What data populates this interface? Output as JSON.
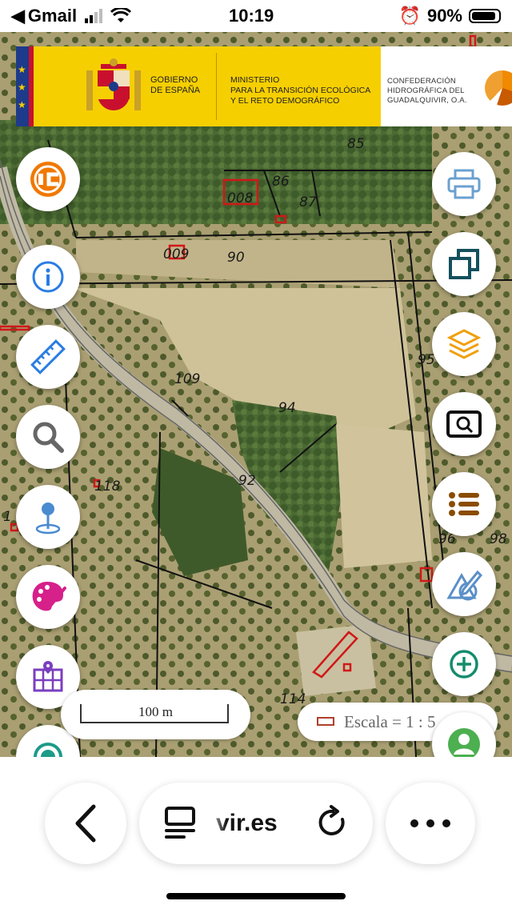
{
  "status_bar": {
    "back_app": "Gmail",
    "time": "10:19",
    "battery_percent": "90%",
    "battery_level": 0.9,
    "signal_bars_on": 2
  },
  "banner": {
    "gov_line1": "GOBIERNO",
    "gov_line2": "DE ESPAÑA",
    "ministry_line1": "MINISTERIO",
    "ministry_line2": "PARA LA TRANSICIÓN ECOLÓGICA",
    "ministry_line3": "Y EL RETO DEMOGRÁFICO",
    "chg_line1": "CONFEDERACIÓN",
    "chg_line2": "HIDROGRÁFICA DEL",
    "chg_line3": "GUADALQUIVIR, O.A.",
    "colors": {
      "yellow": "#f6cf00",
      "blue": "#1e3a8a",
      "red": "#c8102e"
    }
  },
  "map": {
    "parcels": {
      "p85": "85",
      "p86": "86",
      "p87": "87",
      "p008": "008",
      "p009": "009",
      "p90": "90",
      "p95": "95",
      "p94": "94",
      "p109": "109",
      "p92": "92",
      "p118": "118",
      "p1": "1",
      "p96": "96",
      "p98": "98",
      "p114": "114"
    },
    "scale_bar_label": "100 m",
    "scale_text": "Escala = 1 : 5"
  },
  "toolbar_left": [
    {
      "icon": "ic-logo-icon"
    },
    {
      "icon": "info-icon"
    },
    {
      "icon": "ruler-icon"
    },
    {
      "icon": "search-icon"
    },
    {
      "icon": "location-pin-icon"
    },
    {
      "icon": "palette-icon"
    },
    {
      "icon": "map-grid-icon"
    },
    {
      "icon": "gps-icon"
    }
  ],
  "toolbar_right": [
    {
      "icon": "print-icon"
    },
    {
      "icon": "copy-icon"
    },
    {
      "icon": "layers-icon"
    },
    {
      "icon": "zoom-extent-icon"
    },
    {
      "icon": "legend-list-icon"
    },
    {
      "icon": "draw-icon"
    },
    {
      "icon": "zoom-in-icon"
    },
    {
      "icon": "user-icon"
    }
  ],
  "browser": {
    "url_domain": "vir.es",
    "icons": [
      "back-arrow-icon",
      "reader-icon",
      "reload-icon",
      "more-icon"
    ]
  }
}
